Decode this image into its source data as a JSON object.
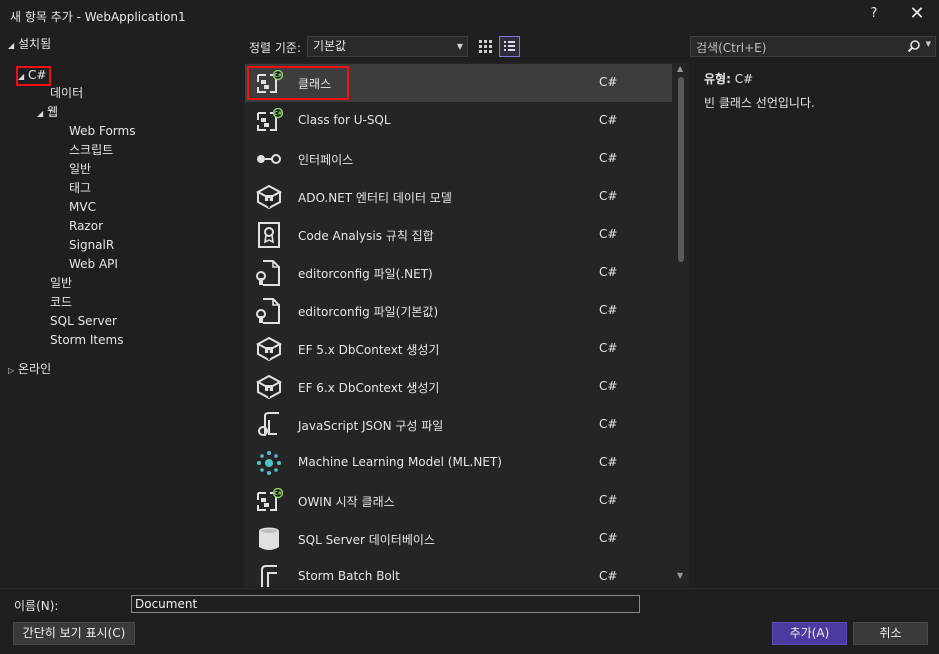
{
  "window": {
    "title": "새 항목 추가 - WebApplication1",
    "help_label": "?",
    "close_label": "✕"
  },
  "tree": {
    "installed": "설치됨",
    "csharp": "C#",
    "data": "데이터",
    "web": "웹",
    "web_children": [
      "Web Forms",
      "스크립트",
      "일반",
      "태그",
      "MVC",
      "Razor",
      "SignalR",
      "Web API"
    ],
    "general": "일반",
    "code": "코드",
    "sql_server": "SQL Server",
    "storm_items": "Storm Items",
    "online": "온라인"
  },
  "toolbar": {
    "sort_label": "정렬 기준:",
    "sort_value": "기본값",
    "search_placeholder": "검색(Ctrl+E)"
  },
  "templates": [
    {
      "name": "클래스",
      "lang": "C#",
      "icon": "class-icon"
    },
    {
      "name": "Class for U-SQL",
      "lang": "C#",
      "icon": "class-icon"
    },
    {
      "name": "인터페이스",
      "lang": "C#",
      "icon": "interface-icon"
    },
    {
      "name": "ADO.NET 엔터티 데이터 모델",
      "lang": "C#",
      "icon": "data-model-icon"
    },
    {
      "name": "Code Analysis 규칙 집합",
      "lang": "C#",
      "icon": "ruleset-icon"
    },
    {
      "name": "editorconfig 파일(.NET)",
      "lang": "C#",
      "icon": "config-file-icon"
    },
    {
      "name": "editorconfig 파일(기본값)",
      "lang": "C#",
      "icon": "config-file-icon"
    },
    {
      "name": "EF 5.x DbContext 생성기",
      "lang": "C#",
      "icon": "data-model-icon"
    },
    {
      "name": "EF 6.x DbContext 생성기",
      "lang": "C#",
      "icon": "data-model-icon"
    },
    {
      "name": "JavaScript JSON 구성 파일",
      "lang": "C#",
      "icon": "json-file-icon"
    },
    {
      "name": "Machine Learning Model (ML.NET)",
      "lang": "C#",
      "icon": "ml-model-icon"
    },
    {
      "name": "OWIN 시작 클래스",
      "lang": "C#",
      "icon": "class-icon"
    },
    {
      "name": "SQL Server 데이터베이스",
      "lang": "C#",
      "icon": "database-icon"
    },
    {
      "name": "Storm Batch Bolt",
      "lang": "C#",
      "icon": "storm-icon"
    }
  ],
  "details": {
    "type_label": "유형:",
    "type_value": "C#",
    "description": "빈 클래스 선언입니다."
  },
  "footer": {
    "name_label": "이름(N):",
    "name_value": "Document",
    "compact_view": "간단히 보기 표시(C)",
    "add": "추가(A)",
    "cancel": "취소"
  },
  "colors": {
    "background": "#1f1f1f",
    "list_background": "#252526",
    "selected_row": "#3d3d3d",
    "accent": "#4d3a9f",
    "highlight_box": "#ee1111",
    "csharp_badge": "#8fd16b"
  }
}
